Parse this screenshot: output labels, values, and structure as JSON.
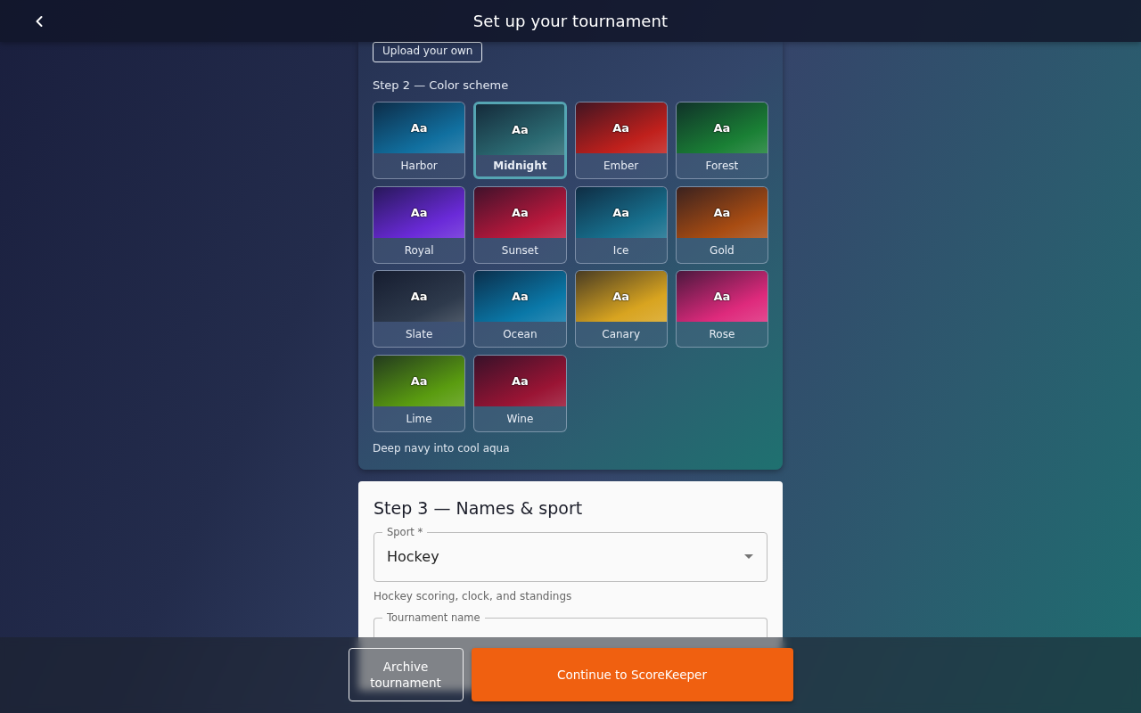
{
  "header": {
    "title": "Set up your tournament"
  },
  "step2": {
    "upload_button": "Upload your own",
    "title": "Step 2 — Color scheme",
    "schemes": [
      {
        "name": "Harbor",
        "sample": "Aa",
        "color": "#1170a0",
        "selected": false
      },
      {
        "name": "Midnight",
        "sample": "Aa",
        "color": "#2b6a72",
        "selected": true
      },
      {
        "name": "Ember",
        "sample": "Aa",
        "color": "#c0201c",
        "selected": false
      },
      {
        "name": "Forest",
        "sample": "Aa",
        "color": "#1a8035",
        "selected": false
      },
      {
        "name": "Royal",
        "sample": "Aa",
        "color": "#6a2ad8",
        "selected": false
      },
      {
        "name": "Sunset",
        "sample": "Aa",
        "color": "#b8183c",
        "selected": false
      },
      {
        "name": "Ice",
        "sample": "Aa",
        "color": "#17708e",
        "selected": false
      },
      {
        "name": "Gold",
        "sample": "Aa",
        "color": "#a84c12",
        "selected": false
      },
      {
        "name": "Slate",
        "sample": "Aa",
        "color": "#2e3a4c",
        "selected": false
      },
      {
        "name": "Ocean",
        "sample": "Aa",
        "color": "#0a78a8",
        "selected": false
      },
      {
        "name": "Canary",
        "sample": "Aa",
        "color": "#d8a420",
        "selected": false
      },
      {
        "name": "Rose",
        "sample": "Aa",
        "color": "#de2a7c",
        "selected": false
      },
      {
        "name": "Lime",
        "sample": "Aa",
        "color": "#5a9c10",
        "selected": false
      },
      {
        "name": "Wine",
        "sample": "Aa",
        "color": "#9a1434",
        "selected": false
      }
    ],
    "description": "Deep navy into cool aqua"
  },
  "step3": {
    "title": "Step 3 — Names & sport",
    "sport": {
      "label": "Sport *",
      "value": "Hockey",
      "helper": "Hockey scoring, clock, and standings"
    },
    "tournament_name": {
      "label": "Tournament name"
    }
  },
  "actions": [
    {
      "label": "Archive tournament",
      "kind": "outlined"
    },
    {
      "label": "Continue to ScoreKeeper",
      "kind": "primary"
    }
  ]
}
